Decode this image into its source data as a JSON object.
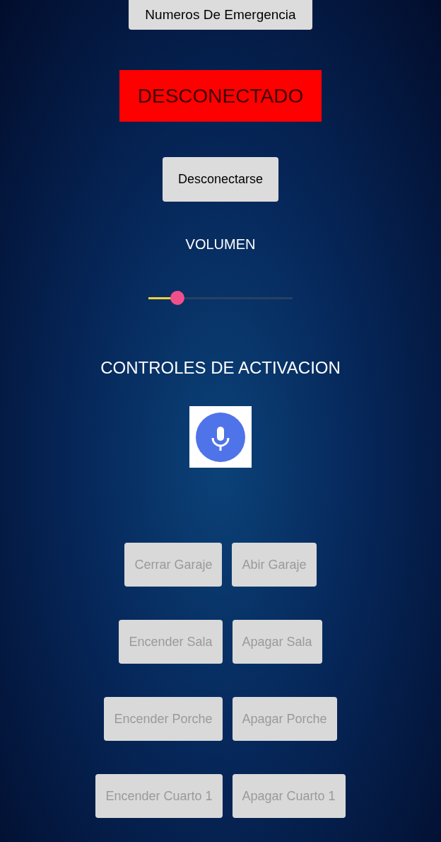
{
  "emergency_button": {
    "label": "Numeros De Emergencia"
  },
  "status": {
    "label": "DESCONECTADO",
    "color": "#ff0000"
  },
  "disconnect_button": {
    "label": "Desconectarse"
  },
  "volume": {
    "label": "VOLUMEN",
    "level": 0.2
  },
  "controls": {
    "title": "CONTROLES DE ACTIVACION",
    "rows": [
      [
        {
          "label": "Cerrar Garaje",
          "disabled": true
        },
        {
          "label": "Abir Garaje",
          "disabled": true
        }
      ],
      [
        {
          "label": "Encender Sala",
          "disabled": true
        },
        {
          "label": "Apagar Sala",
          "disabled": true
        }
      ],
      [
        {
          "label": "Encender Porche",
          "disabled": true
        },
        {
          "label": "Apagar Porche",
          "disabled": true
        }
      ],
      [
        {
          "label": "Encender Cuarto 1",
          "disabled": true
        },
        {
          "label": "Apagar Cuarto 1",
          "disabled": true
        }
      ]
    ]
  }
}
